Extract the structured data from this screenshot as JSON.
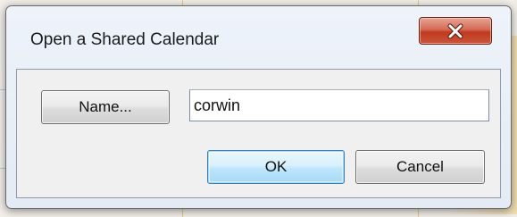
{
  "dialog": {
    "title": "Open a Shared Calendar",
    "close_icon": "close-icon"
  },
  "form": {
    "name_button_label": "Name...",
    "name_input_value": "corwin"
  },
  "actions": {
    "ok_label": "OK",
    "cancel_label": "Cancel"
  },
  "colors": {
    "close_button": "#c9553a",
    "ok_button_border": "#3c7fb1",
    "dialog_background": "#eef3fa"
  }
}
